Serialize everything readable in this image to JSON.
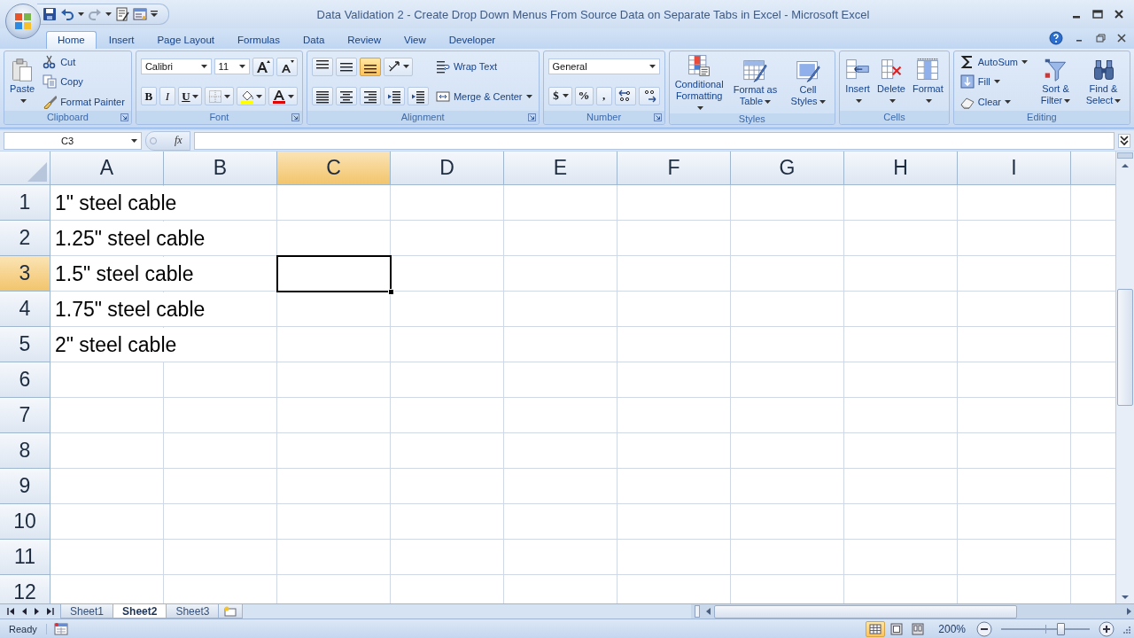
{
  "window": {
    "title": "Data Validation 2 - Create Drop Down Menus From Source Data on Separate Tabs in Excel - Microsoft Excel"
  },
  "tabs": [
    {
      "label": "Home",
      "selected": true
    },
    {
      "label": "Insert",
      "selected": false
    },
    {
      "label": "Page Layout",
      "selected": false
    },
    {
      "label": "Formulas",
      "selected": false
    },
    {
      "label": "Data",
      "selected": false
    },
    {
      "label": "Review",
      "selected": false
    },
    {
      "label": "View",
      "selected": false
    },
    {
      "label": "Developer",
      "selected": false
    }
  ],
  "ribbon": [
    {
      "label": "Clipboard",
      "launcher": true,
      "columns": [
        [
          [
            {
              "kind": "large",
              "label": "Paste",
              "dropdown": true
            }
          ]
        ],
        [
          [
            {
              "kind": "small",
              "label": "Cut"
            }
          ],
          [
            {
              "kind": "small",
              "label": "Copy"
            }
          ],
          [
            {
              "kind": "small",
              "label": "Format Painter"
            }
          ]
        ]
      ]
    },
    {
      "label": "Font",
      "launcher": true,
      "columns": [
        [
          [
            {
              "kind": "combo",
              "value": "Calibri"
            },
            {
              "kind": "combo",
              "value": "11"
            },
            {
              "kind": "icon"
            },
            {
              "kind": "icon"
            }
          ],
          [
            {
              "kind": "bold",
              "label": "B",
              "selected": false
            },
            {
              "kind": "italic",
              "label": "I",
              "selected": false
            },
            {
              "kind": "underline",
              "label": "U",
              "selected": false,
              "dropdown": true
            },
            {
              "kind": "icon",
              "dropdown": true
            },
            {
              "kind": "icon",
              "dropdown": true
            },
            {
              "kind": "icon",
              "dropdown": true
            }
          ]
        ]
      ]
    },
    {
      "label": "Alignment",
      "launcher": true,
      "columns": [
        [
          [
            {
              "kind": "icon",
              "selected": false
            },
            {
              "kind": "icon",
              "selected": false
            },
            {
              "kind": "icon",
              "selected": true
            },
            {
              "kind": "icon",
              "dropdown": true
            }
          ],
          [
            {
              "kind": "icon",
              "selected": false
            },
            {
              "kind": "icon",
              "selected": false
            },
            {
              "kind": "icon",
              "selected": false
            },
            {
              "kind": "icon"
            },
            {
              "kind": "icon"
            }
          ]
        ],
        [
          [
            {
              "kind": "small",
              "label": "Wrap Text"
            }
          ],
          [
            {
              "kind": "small",
              "label": "Merge & Center",
              "dropdown": true
            }
          ]
        ]
      ]
    },
    {
      "label": "Number",
      "launcher": true,
      "columns": [
        [
          [
            {
              "kind": "combo",
              "value": "General"
            }
          ],
          [
            {
              "kind": "symbol",
              "label": "$",
              "dropdown": true
            },
            {
              "kind": "symbol",
              "label": "%"
            },
            {
              "kind": "symbol",
              "label": ","
            },
            {
              "kind": "icon"
            },
            {
              "kind": "icon"
            }
          ]
        ]
      ]
    },
    {
      "label": "Styles",
      "launcher": false,
      "columns": [
        [
          [
            {
              "kind": "large",
              "label": "Conditional Formatting",
              "dropdown": true
            }
          ]
        ],
        [
          [
            {
              "kind": "large",
              "label": "Format as Table",
              "dropdown": true
            }
          ]
        ],
        [
          [
            {
              "kind": "large",
              "label": "Cell Styles",
              "dropdown": true
            }
          ]
        ]
      ]
    },
    {
      "label": "Cells",
      "launcher": false,
      "columns": [
        [
          [
            {
              "kind": "large",
              "label": "Insert",
              "dropdown": true
            }
          ]
        ],
        [
          [
            {
              "kind": "large",
              "label": "Delete",
              "dropdown": true
            }
          ]
        ],
        [
          [
            {
              "kind": "large",
              "label": "Format",
              "dropdown": true
            }
          ]
        ]
      ]
    },
    {
      "label": "Editing",
      "launcher": false,
      "columns": [
        [
          [
            {
              "kind": "small",
              "label": "AutoSum",
              "dropdown": true
            }
          ],
          [
            {
              "kind": "small",
              "label": "Fill",
              "dropdown": true
            }
          ],
          [
            {
              "kind": "small",
              "label": "Clear",
              "dropdown": true
            }
          ]
        ],
        [
          [
            {
              "kind": "large",
              "label": "Sort & Filter",
              "dropdown": true
            }
          ]
        ],
        [
          [
            {
              "kind": "large",
              "label": "Find & Select",
              "dropdown": true
            }
          ]
        ]
      ]
    }
  ],
  "formula_bar": {
    "name_box": "C3",
    "function_label": "fx"
  },
  "sheet": {
    "columns": [
      {
        "label": "A",
        "selected": false
      },
      {
        "label": "B",
        "selected": false
      },
      {
        "label": "C",
        "selected": true
      },
      {
        "label": "D",
        "selected": false
      },
      {
        "label": "E",
        "selected": false
      },
      {
        "label": "F",
        "selected": false
      },
      {
        "label": "G",
        "selected": false
      },
      {
        "label": "H",
        "selected": false
      },
      {
        "label": "I",
        "selected": false
      }
    ],
    "rows": [
      {
        "label": "1",
        "selected": false,
        "text": "1\" steel cable"
      },
      {
        "label": "2",
        "selected": false,
        "text": "1.25\" steel cable"
      },
      {
        "label": "3",
        "selected": true,
        "text": "1.5\" steel cable"
      },
      {
        "label": "4",
        "selected": false,
        "text": "1.75\" steel cable"
      },
      {
        "label": "5",
        "selected": false,
        "text": "2\" steel cable"
      },
      {
        "label": "6",
        "selected": false
      },
      {
        "label": "7",
        "selected": false
      },
      {
        "label": "8",
        "selected": false
      },
      {
        "label": "9",
        "selected": false
      },
      {
        "label": "10",
        "selected": false
      },
      {
        "label": "11",
        "selected": false
      },
      {
        "label": "12",
        "selected": false
      }
    ]
  },
  "sheet_tabs": [
    {
      "label": "Sheet1",
      "selected": false
    },
    {
      "label": "Sheet2",
      "selected": true
    },
    {
      "label": "Sheet3",
      "selected": false
    }
  ],
  "status_bar": {
    "status": "Ready",
    "view_buttons": [
      {
        "selected": true
      },
      {
        "selected": false
      },
      {
        "selected": false
      }
    ],
    "zoom": "200%",
    "zoom_slider": {
      "level": 0.66
    }
  }
}
